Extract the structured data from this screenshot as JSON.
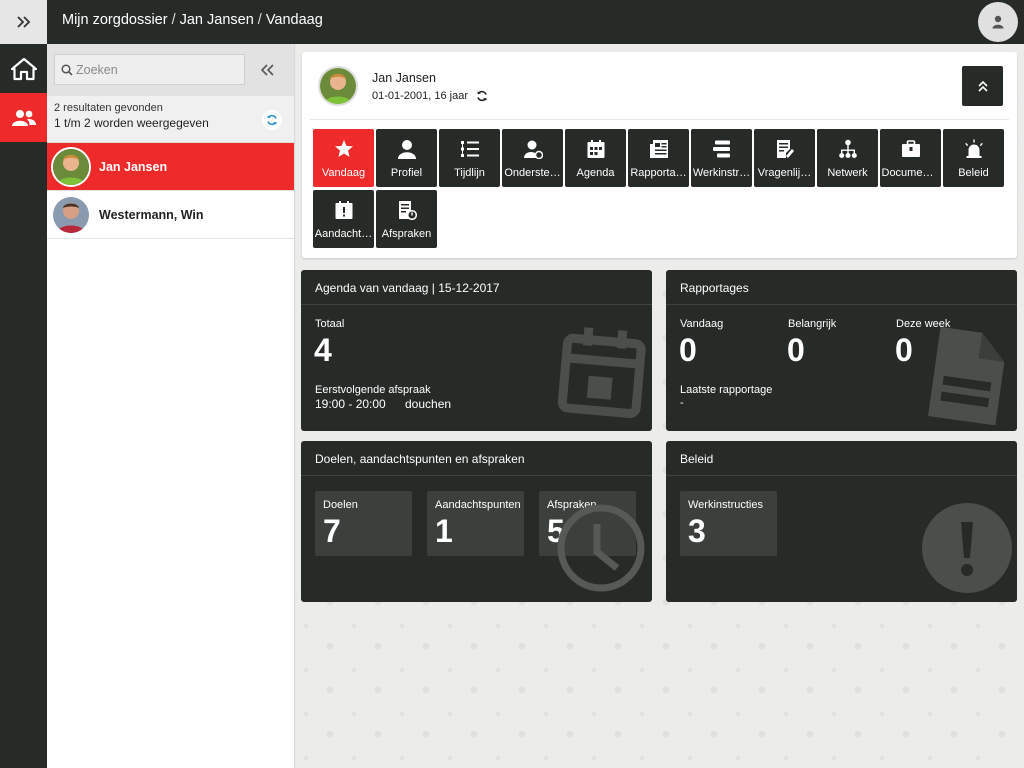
{
  "topbar": {
    "breadcrumb": [
      "Mijn zorgdossier",
      "Jan Jansen",
      "Vandaag"
    ],
    "separator": "/"
  },
  "search": {
    "placeholder": "Zoeken"
  },
  "results": {
    "found": "2 resultaten gevonden",
    "shown": "1 t/m 2 worden weergegeven"
  },
  "patients": [
    {
      "name": "Jan Jansen",
      "active": true
    },
    {
      "name": "Westermann, Win",
      "active": false
    }
  ],
  "profile": {
    "name": "Jan Jansen",
    "dob": "01-01-2001, 16 jaar"
  },
  "tabs": [
    {
      "label": "Vandaag",
      "icon": "star-icon"
    },
    {
      "label": "Profiel",
      "icon": "person-icon"
    },
    {
      "label": "Tijdlijn",
      "icon": "timeline-icon"
    },
    {
      "label": "Onderste…",
      "icon": "support-icon"
    },
    {
      "label": "Agenda",
      "icon": "calendar-icon"
    },
    {
      "label": "Rapporta…",
      "icon": "report-icon"
    },
    {
      "label": "Werkinstr…",
      "icon": "instructions-icon"
    },
    {
      "label": "Vragenlij…",
      "icon": "questionnaire-icon"
    },
    {
      "label": "Netwerk",
      "icon": "network-icon"
    },
    {
      "label": "Documen…",
      "icon": "briefcase-icon"
    },
    {
      "label": "Beleid",
      "icon": "alarm-icon"
    },
    {
      "label": "Aandacht…",
      "icon": "attention-icon"
    },
    {
      "label": "Afspraken",
      "icon": "appointment-icon"
    }
  ],
  "agenda": {
    "title": "Agenda van vandaag | 15-12-2017",
    "total_label": "Totaal",
    "total": "4",
    "next_label": "Eerstvolgende afspraak",
    "next_time": "19:00 - 20:00",
    "next_desc": "douchen"
  },
  "rapportages": {
    "title": "Rapportages",
    "today_label": "Vandaag",
    "today": "0",
    "important_label": "Belangrijk",
    "important": "0",
    "week_label": "Deze week",
    "week": "0",
    "last_label": "Laatste rapportage",
    "last": "-"
  },
  "doelen": {
    "title": "Doelen, aandachtspunten en afspraken",
    "tiles": [
      {
        "label": "Doelen",
        "value": "7"
      },
      {
        "label": "Aandachtspunten",
        "value": "1"
      },
      {
        "label": "Afspraken",
        "value": "5"
      }
    ]
  },
  "beleid": {
    "title": "Beleid",
    "tiles": [
      {
        "label": "Werkinstructies",
        "value": "3"
      }
    ]
  },
  "colors": {
    "accent": "#ee2a2a",
    "dark": "#262b27",
    "tile": "#3b403c"
  }
}
